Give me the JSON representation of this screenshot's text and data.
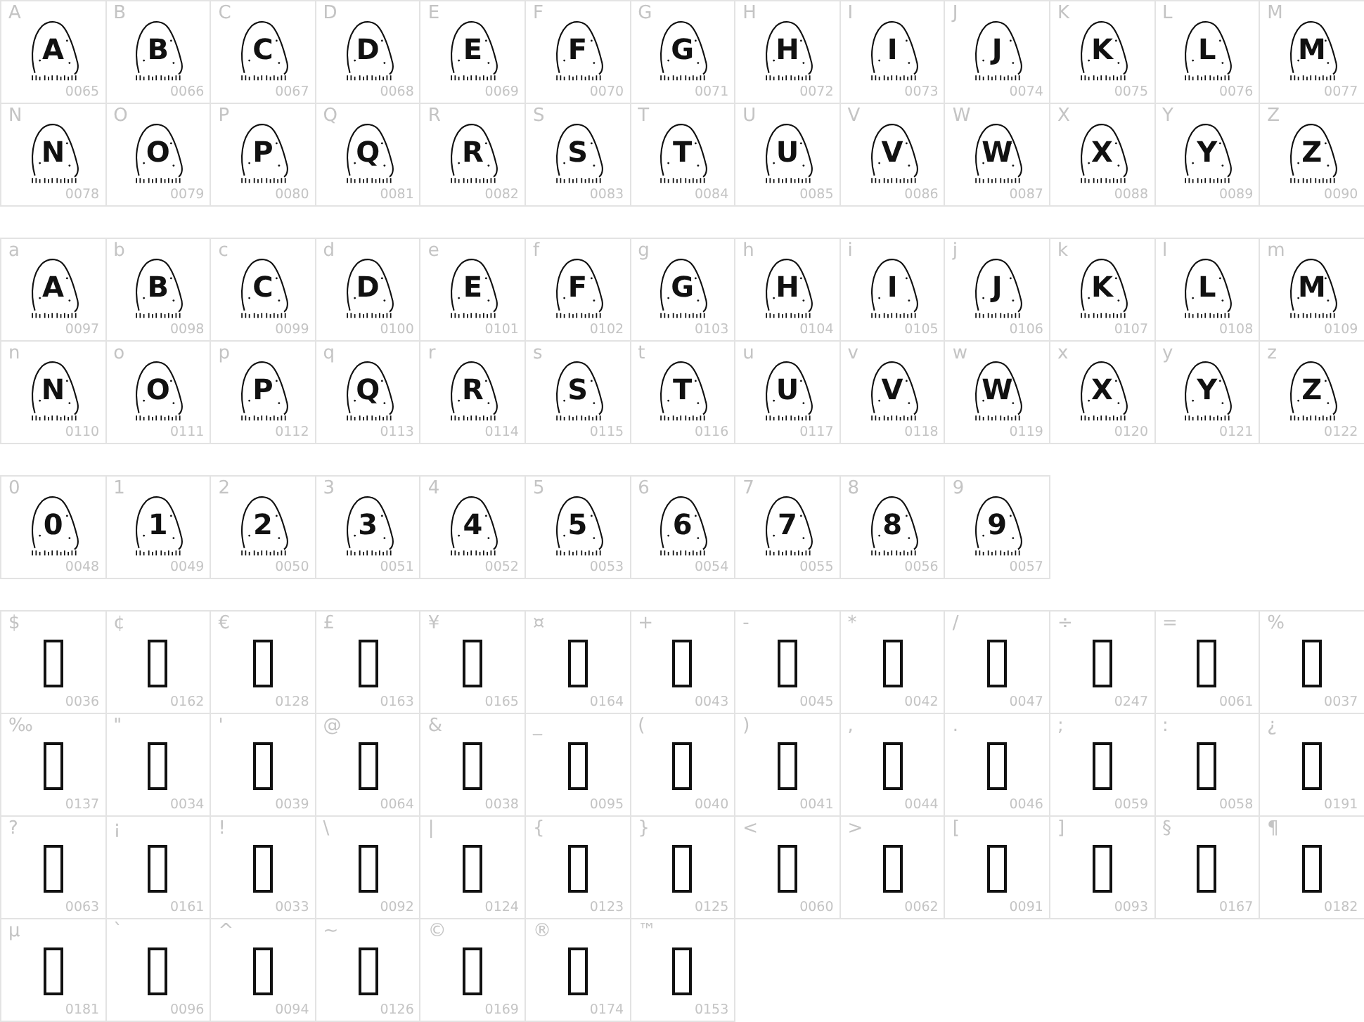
{
  "sections": [
    {
      "cells": [
        {
          "label": "A",
          "code": "0065",
          "kind": "rock",
          "glyph": "A"
        },
        {
          "label": "B",
          "code": "0066",
          "kind": "rock",
          "glyph": "B"
        },
        {
          "label": "C",
          "code": "0067",
          "kind": "rock",
          "glyph": "C"
        },
        {
          "label": "D",
          "code": "0068",
          "kind": "rock",
          "glyph": "D"
        },
        {
          "label": "E",
          "code": "0069",
          "kind": "rock",
          "glyph": "E"
        },
        {
          "label": "F",
          "code": "0070",
          "kind": "rock",
          "glyph": "F"
        },
        {
          "label": "G",
          "code": "0071",
          "kind": "rock",
          "glyph": "G"
        },
        {
          "label": "H",
          "code": "0072",
          "kind": "rock",
          "glyph": "H"
        },
        {
          "label": "I",
          "code": "0073",
          "kind": "rock",
          "glyph": "I"
        },
        {
          "label": "J",
          "code": "0074",
          "kind": "rock",
          "glyph": "J"
        },
        {
          "label": "K",
          "code": "0075",
          "kind": "rock",
          "glyph": "K"
        },
        {
          "label": "L",
          "code": "0076",
          "kind": "rock",
          "glyph": "L"
        },
        {
          "label": "M",
          "code": "0077",
          "kind": "rock",
          "glyph": "M"
        },
        {
          "label": "N",
          "code": "0078",
          "kind": "rock",
          "glyph": "N"
        },
        {
          "label": "O",
          "code": "0079",
          "kind": "rock",
          "glyph": "O"
        },
        {
          "label": "P",
          "code": "0080",
          "kind": "rock",
          "glyph": "P"
        },
        {
          "label": "Q",
          "code": "0081",
          "kind": "rock",
          "glyph": "Q"
        },
        {
          "label": "R",
          "code": "0082",
          "kind": "rock",
          "glyph": "R"
        },
        {
          "label": "S",
          "code": "0083",
          "kind": "rock",
          "glyph": "S"
        },
        {
          "label": "T",
          "code": "0084",
          "kind": "rock",
          "glyph": "T"
        },
        {
          "label": "U",
          "code": "0085",
          "kind": "rock",
          "glyph": "U"
        },
        {
          "label": "V",
          "code": "0086",
          "kind": "rock",
          "glyph": "V"
        },
        {
          "label": "W",
          "code": "0087",
          "kind": "rock",
          "glyph": "W"
        },
        {
          "label": "X",
          "code": "0088",
          "kind": "rock",
          "glyph": "X"
        },
        {
          "label": "Y",
          "code": "0089",
          "kind": "rock",
          "glyph": "Y"
        },
        {
          "label": "Z",
          "code": "0090",
          "kind": "rock",
          "glyph": "Z"
        }
      ]
    },
    {
      "cells": [
        {
          "label": "a",
          "code": "0097",
          "kind": "rock",
          "glyph": "A"
        },
        {
          "label": "b",
          "code": "0098",
          "kind": "rock",
          "glyph": "B"
        },
        {
          "label": "c",
          "code": "0099",
          "kind": "rock",
          "glyph": "C"
        },
        {
          "label": "d",
          "code": "0100",
          "kind": "rock",
          "glyph": "D"
        },
        {
          "label": "e",
          "code": "0101",
          "kind": "rock",
          "glyph": "E"
        },
        {
          "label": "f",
          "code": "0102",
          "kind": "rock",
          "glyph": "F"
        },
        {
          "label": "g",
          "code": "0103",
          "kind": "rock",
          "glyph": "G"
        },
        {
          "label": "h",
          "code": "0104",
          "kind": "rock",
          "glyph": "H"
        },
        {
          "label": "i",
          "code": "0105",
          "kind": "rock",
          "glyph": "I"
        },
        {
          "label": "j",
          "code": "0106",
          "kind": "rock",
          "glyph": "J"
        },
        {
          "label": "k",
          "code": "0107",
          "kind": "rock",
          "glyph": "K"
        },
        {
          "label": "l",
          "code": "0108",
          "kind": "rock",
          "glyph": "L"
        },
        {
          "label": "m",
          "code": "0109",
          "kind": "rock",
          "glyph": "M"
        },
        {
          "label": "n",
          "code": "0110",
          "kind": "rock",
          "glyph": "N"
        },
        {
          "label": "o",
          "code": "0111",
          "kind": "rock",
          "glyph": "O"
        },
        {
          "label": "p",
          "code": "0112",
          "kind": "rock",
          "glyph": "P"
        },
        {
          "label": "q",
          "code": "0113",
          "kind": "rock",
          "glyph": "Q"
        },
        {
          "label": "r",
          "code": "0114",
          "kind": "rock",
          "glyph": "R"
        },
        {
          "label": "s",
          "code": "0115",
          "kind": "rock",
          "glyph": "S"
        },
        {
          "label": "t",
          "code": "0116",
          "kind": "rock",
          "glyph": "T"
        },
        {
          "label": "u",
          "code": "0117",
          "kind": "rock",
          "glyph": "U"
        },
        {
          "label": "v",
          "code": "0118",
          "kind": "rock",
          "glyph": "V"
        },
        {
          "label": "w",
          "code": "0119",
          "kind": "rock",
          "glyph": "W"
        },
        {
          "label": "x",
          "code": "0120",
          "kind": "rock",
          "glyph": "X"
        },
        {
          "label": "y",
          "code": "0121",
          "kind": "rock",
          "glyph": "Y"
        },
        {
          "label": "z",
          "code": "0122",
          "kind": "rock",
          "glyph": "Z"
        }
      ]
    },
    {
      "cells": [
        {
          "label": "0",
          "code": "0048",
          "kind": "rock",
          "glyph": "0"
        },
        {
          "label": "1",
          "code": "0049",
          "kind": "rock",
          "glyph": "1"
        },
        {
          "label": "2",
          "code": "0050",
          "kind": "rock",
          "glyph": "2"
        },
        {
          "label": "3",
          "code": "0051",
          "kind": "rock",
          "glyph": "3"
        },
        {
          "label": "4",
          "code": "0052",
          "kind": "rock",
          "glyph": "4"
        },
        {
          "label": "5",
          "code": "0053",
          "kind": "rock",
          "glyph": "5"
        },
        {
          "label": "6",
          "code": "0054",
          "kind": "rock",
          "glyph": "6"
        },
        {
          "label": "7",
          "code": "0055",
          "kind": "rock",
          "glyph": "7"
        },
        {
          "label": "8",
          "code": "0056",
          "kind": "rock",
          "glyph": "8"
        },
        {
          "label": "9",
          "code": "0057",
          "kind": "rock",
          "glyph": "9"
        }
      ]
    },
    {
      "cells": [
        {
          "label": "$",
          "code": "0036",
          "kind": "missing"
        },
        {
          "label": "¢",
          "code": "0162",
          "kind": "missing"
        },
        {
          "label": "€",
          "code": "0128",
          "kind": "missing"
        },
        {
          "label": "£",
          "code": "0163",
          "kind": "missing"
        },
        {
          "label": "¥",
          "code": "0165",
          "kind": "missing"
        },
        {
          "label": "¤",
          "code": "0164",
          "kind": "missing"
        },
        {
          "label": "+",
          "code": "0043",
          "kind": "missing"
        },
        {
          "label": "-",
          "code": "0045",
          "kind": "missing"
        },
        {
          "label": "*",
          "code": "0042",
          "kind": "missing"
        },
        {
          "label": "/",
          "code": "0047",
          "kind": "missing"
        },
        {
          "label": "÷",
          "code": "0247",
          "kind": "missing"
        },
        {
          "label": "=",
          "code": "0061",
          "kind": "missing"
        },
        {
          "label": "%",
          "code": "0037",
          "kind": "missing"
        },
        {
          "label": "‰",
          "code": "0137",
          "kind": "missing"
        },
        {
          "label": "\"",
          "code": "0034",
          "kind": "missing"
        },
        {
          "label": "'",
          "code": "0039",
          "kind": "missing"
        },
        {
          "label": "@",
          "code": "0064",
          "kind": "missing"
        },
        {
          "label": "&",
          "code": "0038",
          "kind": "missing"
        },
        {
          "label": "_",
          "code": "0095",
          "kind": "missing"
        },
        {
          "label": "(",
          "code": "0040",
          "kind": "missing"
        },
        {
          "label": ")",
          "code": "0041",
          "kind": "missing"
        },
        {
          "label": ",",
          "code": "0044",
          "kind": "missing"
        },
        {
          "label": ".",
          "code": "0046",
          "kind": "missing"
        },
        {
          "label": ";",
          "code": "0059",
          "kind": "missing"
        },
        {
          "label": ":",
          "code": "0058",
          "kind": "missing"
        },
        {
          "label": "¿",
          "code": "0191",
          "kind": "missing"
        },
        {
          "label": "?",
          "code": "0063",
          "kind": "missing"
        },
        {
          "label": "¡",
          "code": "0161",
          "kind": "missing"
        },
        {
          "label": "!",
          "code": "0033",
          "kind": "missing"
        },
        {
          "label": "\\",
          "code": "0092",
          "kind": "missing"
        },
        {
          "label": "|",
          "code": "0124",
          "kind": "missing"
        },
        {
          "label": "{",
          "code": "0123",
          "kind": "missing"
        },
        {
          "label": "}",
          "code": "0125",
          "kind": "missing"
        },
        {
          "label": "<",
          "code": "0060",
          "kind": "missing"
        },
        {
          "label": ">",
          "code": "0062",
          "kind": "missing"
        },
        {
          "label": "[",
          "code": "0091",
          "kind": "missing"
        },
        {
          "label": "]",
          "code": "0093",
          "kind": "missing"
        },
        {
          "label": "§",
          "code": "0167",
          "kind": "missing"
        },
        {
          "label": "¶",
          "code": "0182",
          "kind": "missing"
        },
        {
          "label": "µ",
          "code": "0181",
          "kind": "missing"
        },
        {
          "label": "`",
          "code": "0096",
          "kind": "missing"
        },
        {
          "label": "^",
          "code": "0094",
          "kind": "missing"
        },
        {
          "label": "~",
          "code": "0126",
          "kind": "missing"
        },
        {
          "label": "©",
          "code": "0169",
          "kind": "missing"
        },
        {
          "label": "®",
          "code": "0174",
          "kind": "missing"
        },
        {
          "label": "™",
          "code": "0153",
          "kind": "missing"
        }
      ]
    }
  ]
}
